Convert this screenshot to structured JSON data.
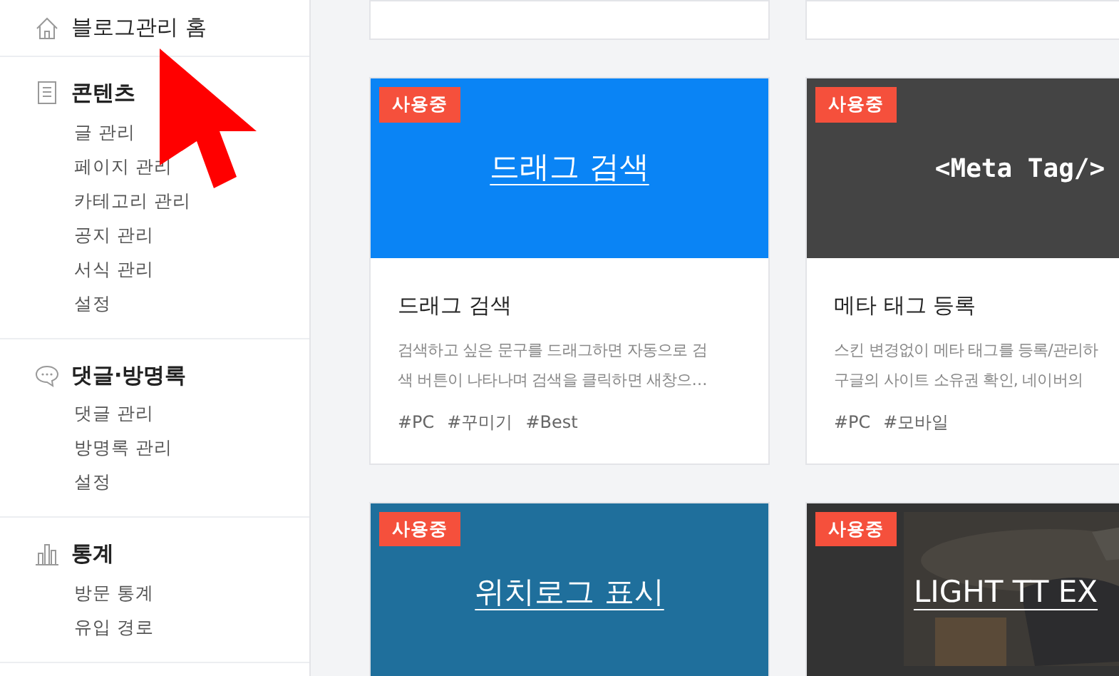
{
  "sidebar": {
    "home": {
      "label": "블로그관리 홈"
    },
    "sections": [
      {
        "title": "콘텐츠",
        "items": [
          "글 관리",
          "페이지 관리",
          "카테고리 관리",
          "공지 관리",
          "서식 관리",
          "설정"
        ]
      },
      {
        "title": "댓글·방명록",
        "items": [
          "댓글 관리",
          "방명록 관리",
          "설정"
        ]
      },
      {
        "title": "통계",
        "items": [
          "방문 통계",
          "유입 경로"
        ]
      }
    ]
  },
  "card_rows": [
    {
      "cards": [
        {
          "kind": "partial"
        },
        {
          "kind": "partial"
        }
      ]
    },
    {
      "cards": [
        {
          "badge": "사용중",
          "thumb": {
            "kind": "plain",
            "color": "#0a84f5",
            "title": "드래그 검색"
          },
          "name": "드래그 검색",
          "description": [
            "검색하고 싶은 문구를 드래그하면 자동으로 검",
            "색 버튼이 나타나며 검색을 클릭하면 새창으…"
          ],
          "tags": [
            "#PC",
            "#꾸미기",
            "#Best"
          ]
        },
        {
          "badge": "사용중",
          "thumb": {
            "kind": "code",
            "color": "#444444",
            "title": "<Meta Tag/>"
          },
          "name": "메타 태그 등록",
          "description": [
            "스킨 변경없이 메타 태그를 등록/관리하",
            "구글의 사이트 소유권 확인, 네이버의"
          ],
          "tags": [
            "#PC",
            "#모바일"
          ]
        }
      ]
    },
    {
      "cards": [
        {
          "badge": "사용중",
          "thumb": {
            "kind": "plain",
            "color": "#1f6f9c",
            "title": "위치로그 표시"
          }
        },
        {
          "badge": "사용중",
          "thumb": {
            "kind": "picture",
            "color": "#333333",
            "title": "LIGHT TT EX"
          }
        }
      ]
    }
  ],
  "annotation": {
    "kind": "arrow",
    "color": "#ff0000"
  }
}
